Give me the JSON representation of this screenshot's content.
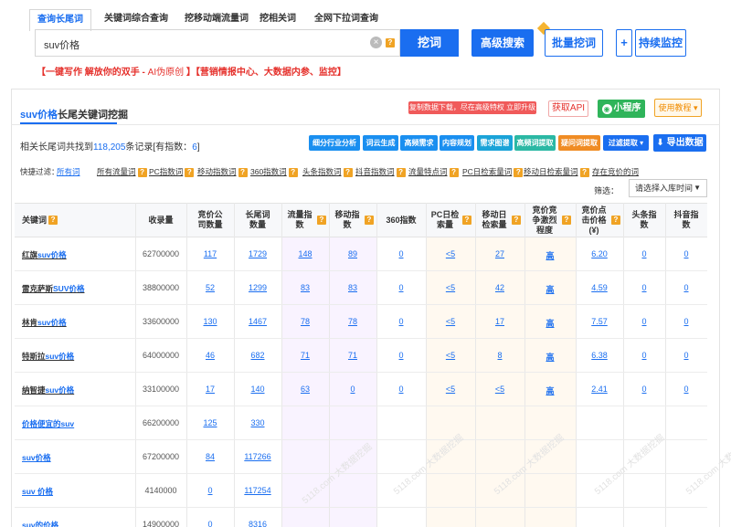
{
  "tabs": [
    "查询长尾词",
    "关键词综合查询",
    "挖移动端流量词",
    "挖相关词",
    "全网下拉词查询"
  ],
  "search": {
    "query": "suv价格",
    "clear_icon": "close-circle-icon",
    "help_icon": "question-icon"
  },
  "buttons": {
    "wa": "挖词",
    "advanced": "高级搜索",
    "batch": "批量挖词",
    "plus": "+",
    "monitor": "持续监控"
  },
  "promo": {
    "part1": "【一键写作 解放你的双手 - ",
    "ai": "AI伪原创",
    "part2": " 】【营销情报中心、大数据内参、监控】"
  },
  "panel": {
    "title_prefix": "suv价格",
    "title_suffix": "长尾关键词挖掘",
    "red_tag": "复制数据下载，尽在高级特权 立即升级",
    "api": "获取API",
    "mini": "小程序",
    "guide": "使用教程 ▾",
    "found_prefix": "相关长尾词共找到",
    "found_count": "118,205",
    "found_mid": "条记录[有指数：",
    "found_idx": "6",
    "found_suffix": "]",
    "actions": [
      "细分行业分析",
      "词云生成",
      "高频需求",
      "内容规划",
      "需求图谱",
      "高频词提取",
      "疑问词提取",
      "过滤提取 ▾"
    ],
    "action_colors": [
      "#1a8ff0",
      "#1a8ff0",
      "#1a8ff0",
      "#1a8ff0",
      "#1aa3d8",
      "#2bb8a4",
      "#f08c24",
      "#1a6ef0"
    ],
    "export": "导出数据",
    "quick_label": "快捷过滤：",
    "quick": [
      "所有词",
      "所有流量词",
      "PC指数词",
      "移动指数词",
      "360指数词",
      "头条指数词",
      "抖音指数词",
      "流量特点词",
      "PC日检索量词",
      "移动日检索量词",
      "存在竞价的词"
    ],
    "filter_label": "筛选：",
    "filter_value": "请选择入库时间"
  },
  "columns": [
    "关键词",
    "收录量",
    "竞价公司数量",
    "长尾词数量",
    "流量指数",
    "移动指数",
    "360指数",
    "PC日检索量",
    "移动日检索量",
    "竞价竞争激烈程度",
    "竞价点击价格(¥)",
    "头条指数",
    "抖音指数"
  ],
  "rows": [
    {
      "kw": [
        "红旗",
        "suv价格"
      ],
      "inc": "62700000",
      "co": "117",
      "lt": "1729",
      "fl": "148",
      "mo": "89",
      "s360": "0",
      "pc": "<5",
      "md": "27",
      "comp": "高",
      "price": "6.20",
      "tt": "0",
      "dy": "0"
    },
    {
      "kw": [
        "雷克萨斯",
        "SUV价格"
      ],
      "inc": "38800000",
      "co": "52",
      "lt": "1299",
      "fl": "83",
      "mo": "83",
      "s360": "0",
      "pc": "<5",
      "md": "42",
      "comp": "高",
      "price": "4.59",
      "tt": "0",
      "dy": "0"
    },
    {
      "kw": [
        "林肯",
        "suv价格"
      ],
      "inc": "33600000",
      "co": "130",
      "lt": "1467",
      "fl": "78",
      "mo": "78",
      "s360": "0",
      "pc": "<5",
      "md": "17",
      "comp": "高",
      "price": "7.57",
      "tt": "0",
      "dy": "0"
    },
    {
      "kw": [
        "特斯拉",
        "suv价格"
      ],
      "inc": "64000000",
      "co": "46",
      "lt": "682",
      "fl": "71",
      "mo": "71",
      "s360": "0",
      "pc": "<5",
      "md": "8",
      "comp": "高",
      "price": "6.38",
      "tt": "0",
      "dy": "0"
    },
    {
      "kw": [
        "纳智捷",
        "suv价格"
      ],
      "inc": "33100000",
      "co": "17",
      "lt": "140",
      "fl": "63",
      "mo": "0",
      "s360": "0",
      "pc": "<5",
      "md": "<5",
      "comp": "高",
      "price": "2.41",
      "tt": "0",
      "dy": "0"
    },
    {
      "kw": [
        "价格便宜的",
        "suv"
      ],
      "inc": "66200000",
      "co": "125",
      "lt": "330"
    },
    {
      "kw": [
        "",
        "suv价格"
      ],
      "inc": "67200000",
      "co": "84",
      "lt": "117266"
    },
    {
      "kw": [
        "",
        "suv 价格"
      ],
      "inc": "4140000",
      "co": "0",
      "lt": "117254"
    },
    {
      "kw": [
        "",
        "suv的价格"
      ],
      "inc": "14900000",
      "co": "0",
      "lt": "8316"
    }
  ],
  "watermark": "5118.com 大数据挖掘"
}
